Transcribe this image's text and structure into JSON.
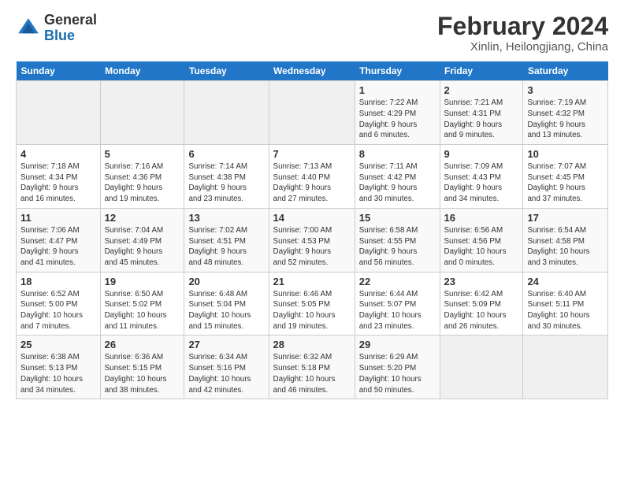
{
  "logo": {
    "general": "General",
    "blue": "Blue"
  },
  "title": "February 2024",
  "subtitle": "Xinlin, Heilongjiang, China",
  "weekdays": [
    "Sunday",
    "Monday",
    "Tuesday",
    "Wednesday",
    "Thursday",
    "Friday",
    "Saturday"
  ],
  "weeks": [
    [
      {
        "day": "",
        "info": ""
      },
      {
        "day": "",
        "info": ""
      },
      {
        "day": "",
        "info": ""
      },
      {
        "day": "",
        "info": ""
      },
      {
        "day": "1",
        "info": "Sunrise: 7:22 AM\nSunset: 4:29 PM\nDaylight: 9 hours\nand 6 minutes."
      },
      {
        "day": "2",
        "info": "Sunrise: 7:21 AM\nSunset: 4:31 PM\nDaylight: 9 hours\nand 9 minutes."
      },
      {
        "day": "3",
        "info": "Sunrise: 7:19 AM\nSunset: 4:32 PM\nDaylight: 9 hours\nand 13 minutes."
      }
    ],
    [
      {
        "day": "4",
        "info": "Sunrise: 7:18 AM\nSunset: 4:34 PM\nDaylight: 9 hours\nand 16 minutes."
      },
      {
        "day": "5",
        "info": "Sunrise: 7:16 AM\nSunset: 4:36 PM\nDaylight: 9 hours\nand 19 minutes."
      },
      {
        "day": "6",
        "info": "Sunrise: 7:14 AM\nSunset: 4:38 PM\nDaylight: 9 hours\nand 23 minutes."
      },
      {
        "day": "7",
        "info": "Sunrise: 7:13 AM\nSunset: 4:40 PM\nDaylight: 9 hours\nand 27 minutes."
      },
      {
        "day": "8",
        "info": "Sunrise: 7:11 AM\nSunset: 4:42 PM\nDaylight: 9 hours\nand 30 minutes."
      },
      {
        "day": "9",
        "info": "Sunrise: 7:09 AM\nSunset: 4:43 PM\nDaylight: 9 hours\nand 34 minutes."
      },
      {
        "day": "10",
        "info": "Sunrise: 7:07 AM\nSunset: 4:45 PM\nDaylight: 9 hours\nand 37 minutes."
      }
    ],
    [
      {
        "day": "11",
        "info": "Sunrise: 7:06 AM\nSunset: 4:47 PM\nDaylight: 9 hours\nand 41 minutes."
      },
      {
        "day": "12",
        "info": "Sunrise: 7:04 AM\nSunset: 4:49 PM\nDaylight: 9 hours\nand 45 minutes."
      },
      {
        "day": "13",
        "info": "Sunrise: 7:02 AM\nSunset: 4:51 PM\nDaylight: 9 hours\nand 48 minutes."
      },
      {
        "day": "14",
        "info": "Sunrise: 7:00 AM\nSunset: 4:53 PM\nDaylight: 9 hours\nand 52 minutes."
      },
      {
        "day": "15",
        "info": "Sunrise: 6:58 AM\nSunset: 4:55 PM\nDaylight: 9 hours\nand 56 minutes."
      },
      {
        "day": "16",
        "info": "Sunrise: 6:56 AM\nSunset: 4:56 PM\nDaylight: 10 hours\nand 0 minutes."
      },
      {
        "day": "17",
        "info": "Sunrise: 6:54 AM\nSunset: 4:58 PM\nDaylight: 10 hours\nand 3 minutes."
      }
    ],
    [
      {
        "day": "18",
        "info": "Sunrise: 6:52 AM\nSunset: 5:00 PM\nDaylight: 10 hours\nand 7 minutes."
      },
      {
        "day": "19",
        "info": "Sunrise: 6:50 AM\nSunset: 5:02 PM\nDaylight: 10 hours\nand 11 minutes."
      },
      {
        "day": "20",
        "info": "Sunrise: 6:48 AM\nSunset: 5:04 PM\nDaylight: 10 hours\nand 15 minutes."
      },
      {
        "day": "21",
        "info": "Sunrise: 6:46 AM\nSunset: 5:05 PM\nDaylight: 10 hours\nand 19 minutes."
      },
      {
        "day": "22",
        "info": "Sunrise: 6:44 AM\nSunset: 5:07 PM\nDaylight: 10 hours\nand 23 minutes."
      },
      {
        "day": "23",
        "info": "Sunrise: 6:42 AM\nSunset: 5:09 PM\nDaylight: 10 hours\nand 26 minutes."
      },
      {
        "day": "24",
        "info": "Sunrise: 6:40 AM\nSunset: 5:11 PM\nDaylight: 10 hours\nand 30 minutes."
      }
    ],
    [
      {
        "day": "25",
        "info": "Sunrise: 6:38 AM\nSunset: 5:13 PM\nDaylight: 10 hours\nand 34 minutes."
      },
      {
        "day": "26",
        "info": "Sunrise: 6:36 AM\nSunset: 5:15 PM\nDaylight: 10 hours\nand 38 minutes."
      },
      {
        "day": "27",
        "info": "Sunrise: 6:34 AM\nSunset: 5:16 PM\nDaylight: 10 hours\nand 42 minutes."
      },
      {
        "day": "28",
        "info": "Sunrise: 6:32 AM\nSunset: 5:18 PM\nDaylight: 10 hours\nand 46 minutes."
      },
      {
        "day": "29",
        "info": "Sunrise: 6:29 AM\nSunset: 5:20 PM\nDaylight: 10 hours\nand 50 minutes."
      },
      {
        "day": "",
        "info": ""
      },
      {
        "day": "",
        "info": ""
      }
    ]
  ]
}
